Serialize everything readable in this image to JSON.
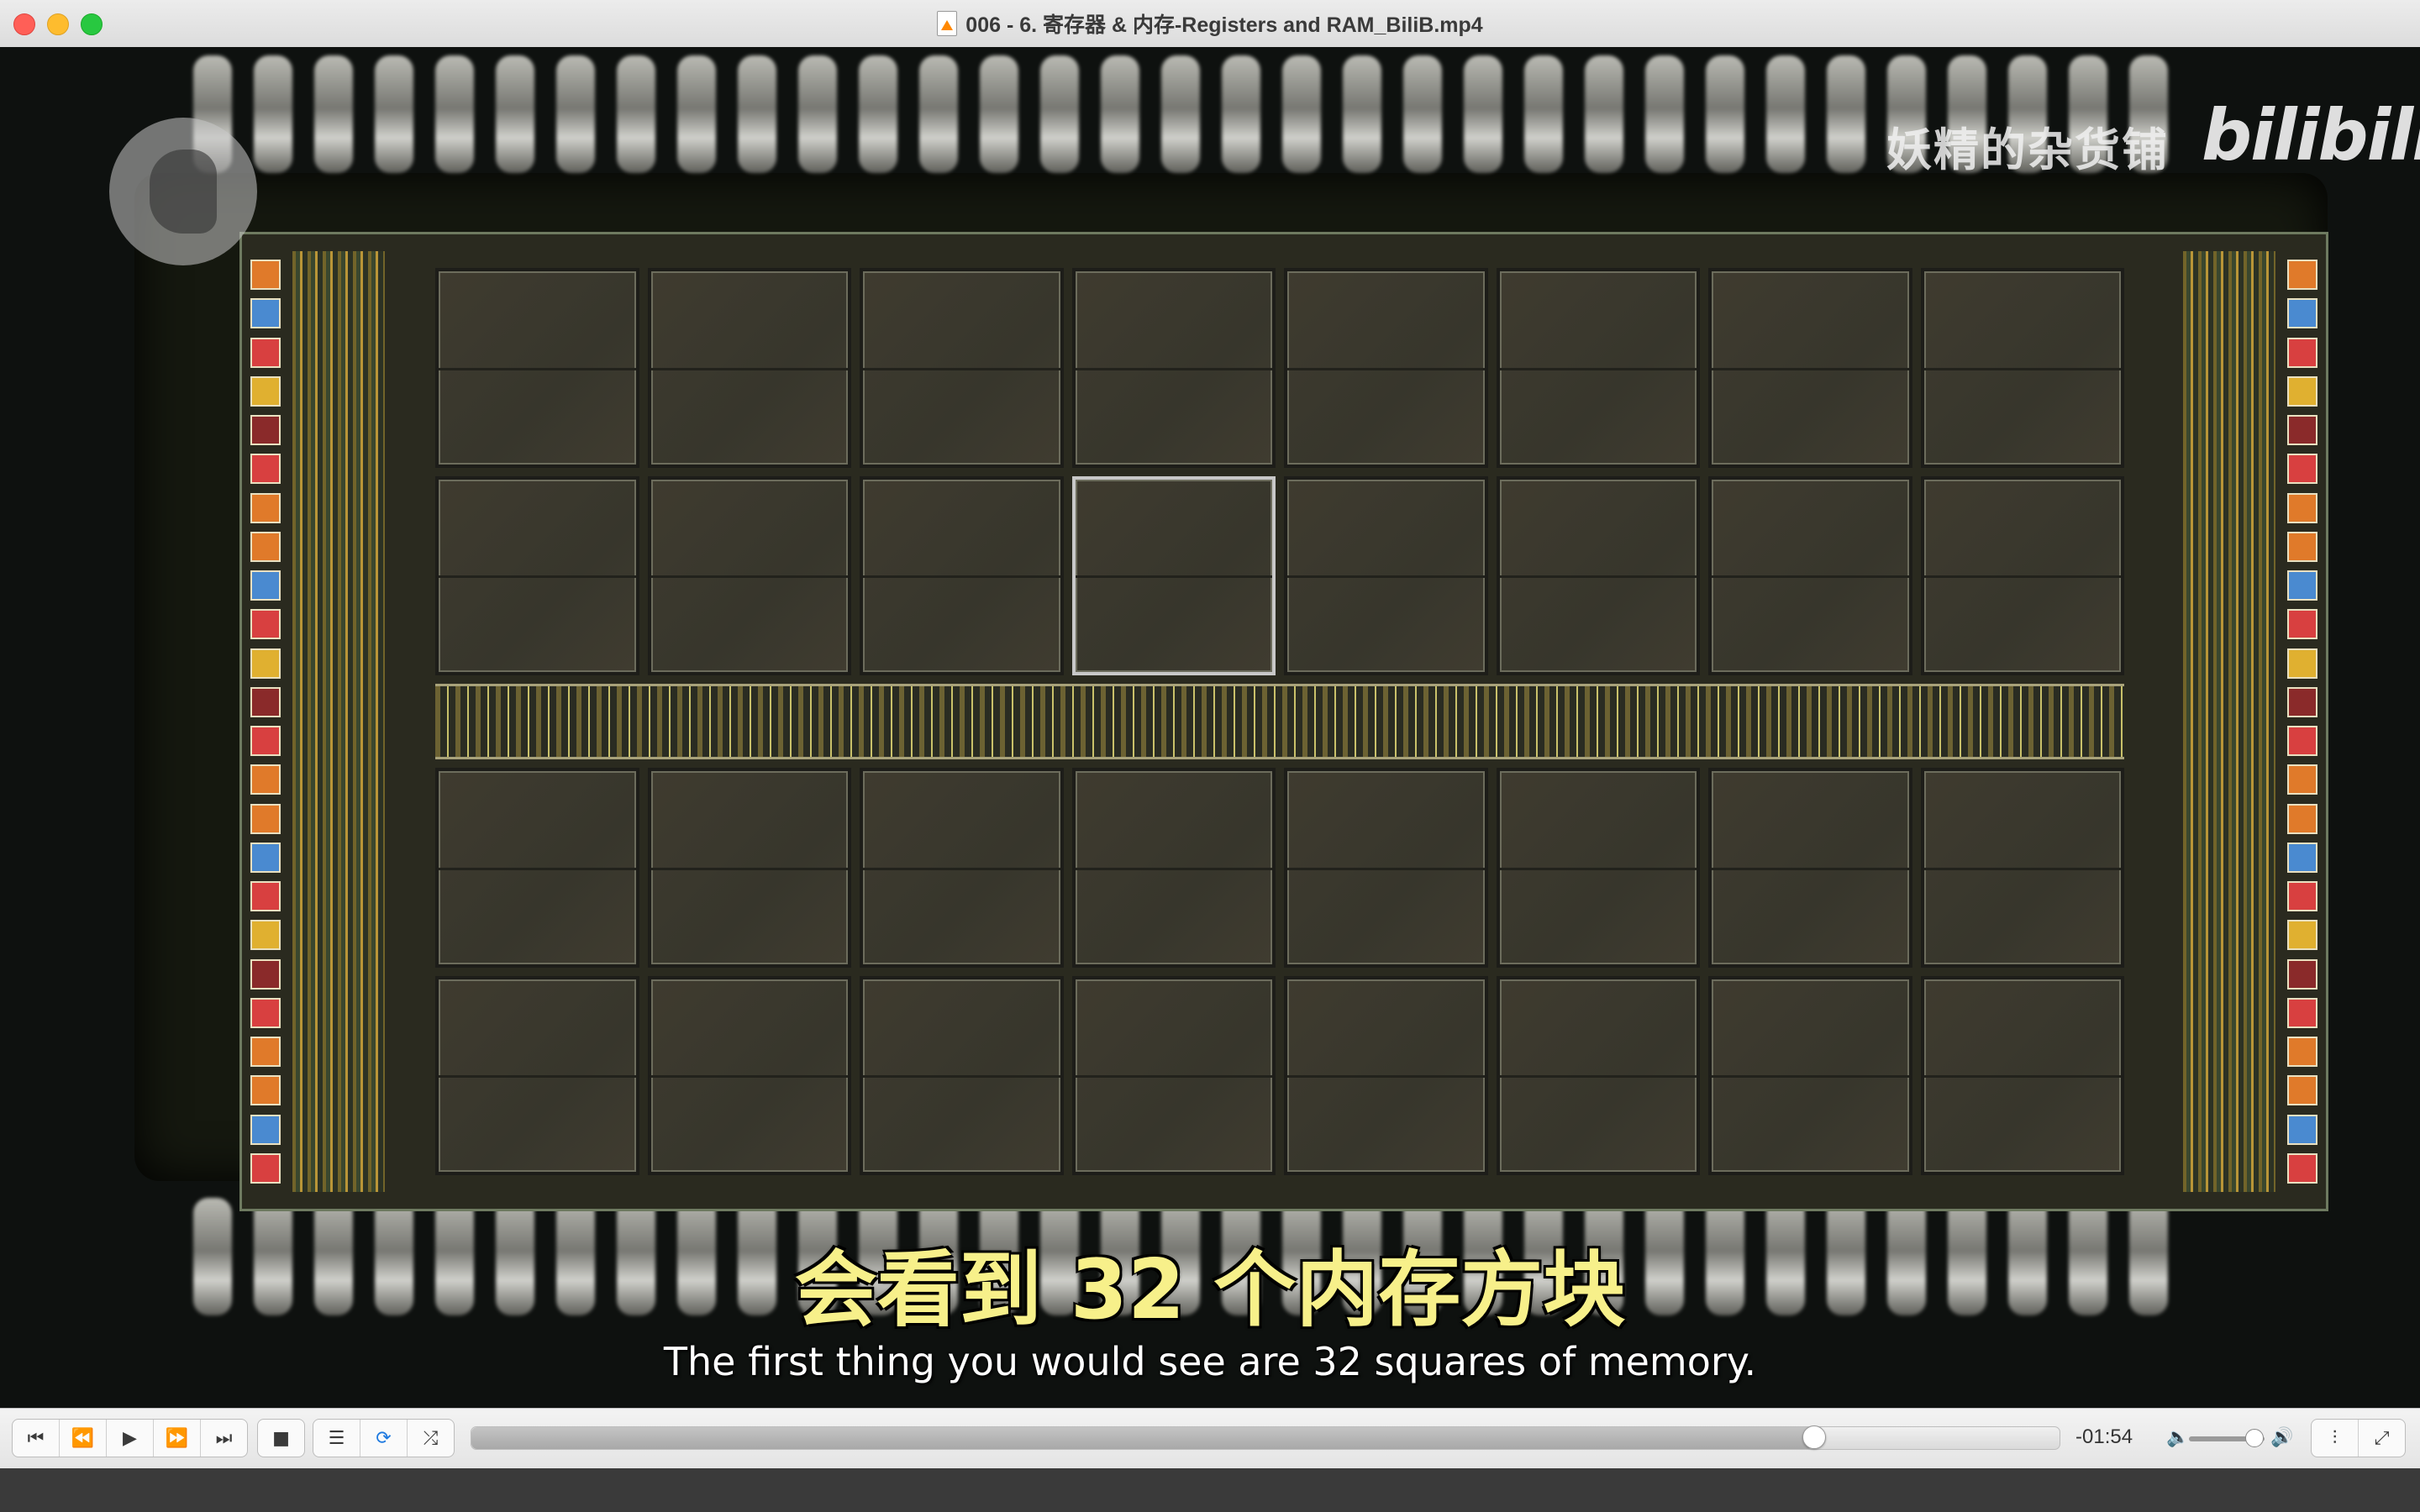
{
  "window": {
    "title": "006 - 6. 寄存器 & 内存-Registers and RAM_BiliB.mp4"
  },
  "video": {
    "watermark_text": "妖精的杂货铺",
    "bilibili_logo": "bilibili",
    "subtitle_cn": "会看到 32 个内存方块",
    "subtitle_en": "The first thing you would see are 32 squares of memory."
  },
  "controls": {
    "playback_buttons": [
      {
        "name": "skip-back",
        "glyph": "⏮"
      },
      {
        "name": "rewind",
        "glyph": "⏪"
      },
      {
        "name": "play",
        "glyph": "▶"
      },
      {
        "name": "fast-forward",
        "glyph": "⏩"
      },
      {
        "name": "skip-forward",
        "glyph": "⏭"
      }
    ],
    "stop_glyph": "■",
    "playlist_glyph": "☰",
    "loop_glyph": "⟳",
    "shuffle_glyph": "⤮",
    "progress_fraction": 0.845,
    "time_remaining": "-01:54",
    "volume_fraction": 0.85,
    "mute_glyph": "🔈",
    "volume_max_glyph": "🔊",
    "equalizer_glyph": "⫶",
    "fullscreen_glyph": "⤢",
    "accent_color": "#1f7ae0"
  }
}
